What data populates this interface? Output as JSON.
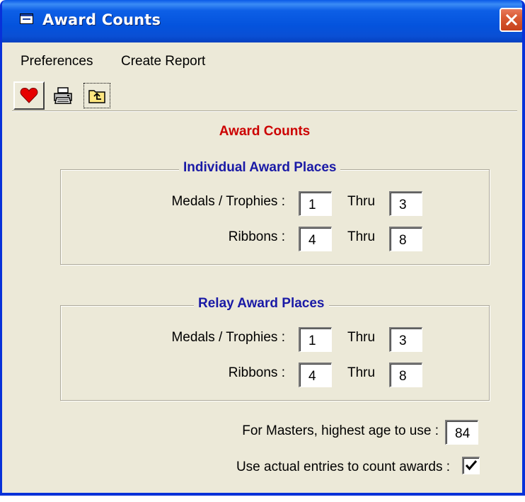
{
  "window": {
    "title": "Award Counts",
    "close_icon": "close-icon"
  },
  "menu": {
    "items": [
      "Preferences",
      "Create Report"
    ]
  },
  "toolbar": {
    "buttons": [
      "heart-icon",
      "printer-icon",
      "up-folder-icon"
    ]
  },
  "form": {
    "heading": "Award Counts",
    "individual": {
      "title": "Individual Award Places",
      "medals_label": "Medals / Trophies :",
      "medals_from": "1",
      "medals_thru_label": "Thru",
      "medals_to": "3",
      "ribbons_label": "Ribbons :",
      "ribbons_from": "4",
      "ribbons_thru_label": "Thru",
      "ribbons_to": "8"
    },
    "relay": {
      "title": "Relay Award Places",
      "medals_label": "Medals / Trophies :",
      "medals_from": "1",
      "medals_thru_label": "Thru",
      "medals_to": "3",
      "ribbons_label": "Ribbons :",
      "ribbons_from": "4",
      "ribbons_thru_label": "Thru",
      "ribbons_to": "8"
    },
    "masters_label": "For Masters, highest age to use :",
    "masters_age": "84",
    "actual_entries_label": "Use actual entries to count awards :",
    "actual_entries_checked": true
  },
  "colors": {
    "title_bar": "#0453dd",
    "window_bg": "#ece9d8",
    "heading_red": "#cc0000",
    "group_title_blue": "#1a1aa6",
    "close_button": "#d95a33"
  }
}
